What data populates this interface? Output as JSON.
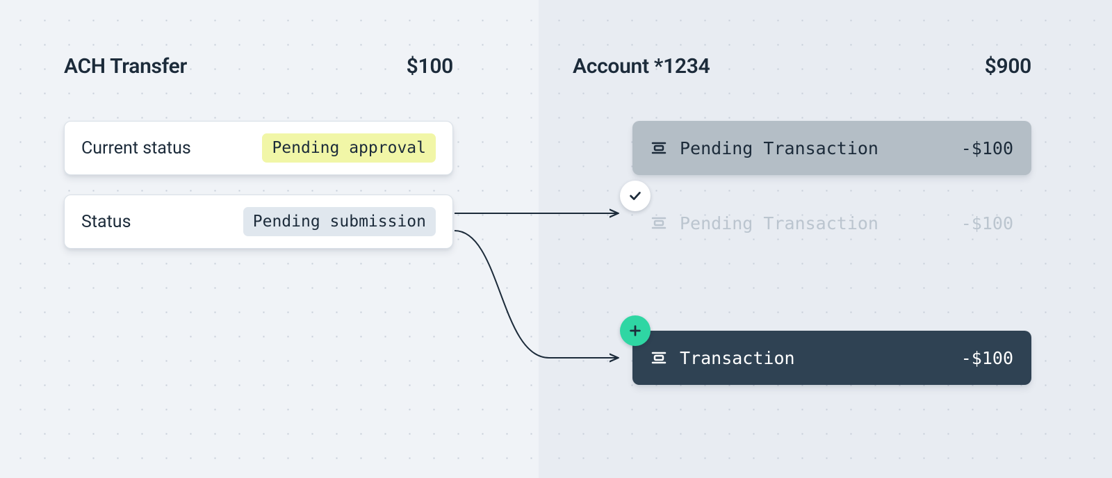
{
  "left": {
    "title": "ACH Transfer",
    "amount": "$100",
    "current_status": {
      "label": "Current status",
      "value": "Pending approval"
    },
    "status": {
      "label": "Status",
      "value": "Pending submission"
    }
  },
  "right": {
    "title": "Account *1234",
    "balance": "$900",
    "pending_solid": {
      "label": "Pending Transaction",
      "amount": "-$100"
    },
    "pending_ghost": {
      "label": "Pending Transaction",
      "amount": "-$100"
    },
    "posted": {
      "label": "Transaction",
      "amount": "-$100"
    }
  },
  "icons": {
    "transaction": "transaction-icon",
    "check": "check-icon",
    "plus": "plus-icon"
  }
}
